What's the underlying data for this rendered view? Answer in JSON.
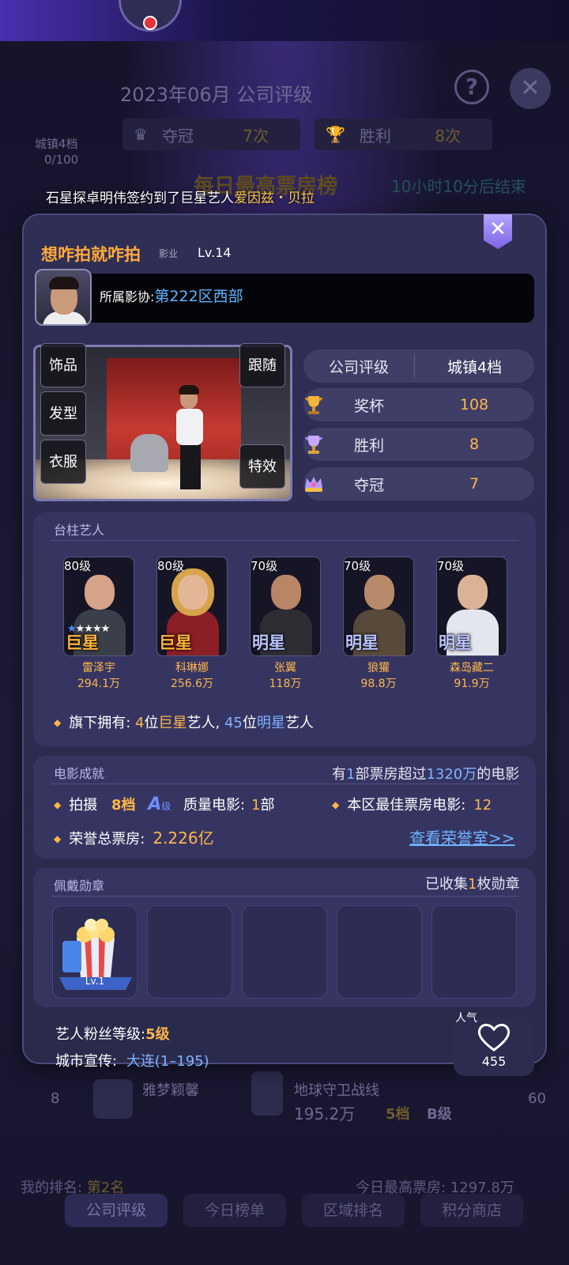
{
  "background": {
    "title": "2023年06月 公司评级",
    "help_icon": "?",
    "champion_label": "夺冠",
    "champion_count": "7次",
    "win_label": "胜利",
    "win_count": "8次",
    "town_level": "城镇4档",
    "town_progress": "0/100",
    "rank_title": "每日最高票房榜",
    "rank_countdown": "10小时10分后结束",
    "row_rank": "8",
    "row_name": "雅梦颖馨",
    "row_movie": "地球守卫战线",
    "row_box": "195.2万",
    "row_grade": "5档",
    "row_level": "B级",
    "row_score": "60",
    "my_rank_label": "我的排名:",
    "my_rank_value": "第2名",
    "today_best_label": "今日最高票房:",
    "today_best_value": "1297.8万",
    "tabs": [
      "公司评级",
      "今日榜单",
      "区域排名",
      "积分商店"
    ]
  },
  "notice": {
    "prefix": "石星探卓明伟签约到了巨星艺人",
    "highlight": "爱因兹・贝拉"
  },
  "panel": {
    "company_name": "想咋拍就咋拍",
    "company_tag": "影业",
    "level": "Lv.14",
    "guild_label": "所属影协:",
    "guild_name": "第222区西部",
    "studio_buttons": {
      "accessories": "饰品",
      "hairstyle": "发型",
      "clothing": "衣服",
      "follow": "跟随",
      "effects": "特效"
    },
    "stats": {
      "rating_label": "公司评级",
      "rating_value": "城镇4档",
      "trophy_label": "奖杯",
      "trophy_value": "108",
      "win_label": "胜利",
      "win_value": "8",
      "champion_label": "夺冠",
      "champion_value": "7"
    },
    "artists_section": {
      "title": "台柱艺人",
      "artists": [
        {
          "level": "80级",
          "rank": "巨星",
          "name": "雷泽宇",
          "fans": "294.1万"
        },
        {
          "level": "80级",
          "rank": "巨星",
          "name": "科琳娜",
          "fans": "256.6万"
        },
        {
          "level": "70级",
          "rank": "明星",
          "name": "张翼",
          "fans": "118万"
        },
        {
          "level": "70级",
          "rank": "明星",
          "name": "狼獾",
          "fans": "98.8万"
        },
        {
          "level": "70级",
          "rank": "明星",
          "name": "森岛藏二",
          "fans": "91.9万"
        }
      ],
      "owned_prefix": "旗下拥有: ",
      "superstar_count": "4",
      "superstar_unit": "位",
      "superstar_label": "巨星",
      "artist_word": "艺人, ",
      "star_count": "45",
      "star_unit": "位",
      "star_label": "明星",
      "artist_word2": "艺人"
    },
    "movies_section": {
      "title": "电影成就",
      "summary_prefix": "有",
      "summary_count": "1",
      "summary_mid": "部票房超过",
      "summary_amount": "1320万",
      "summary_suffix": "的电影",
      "shoot_label": "拍摄",
      "shoot_grade": "8档",
      "shoot_level": "A",
      "shoot_level_unit": "级",
      "quality_label": "质量电影:",
      "quality_count": "1",
      "quality_unit": "部",
      "best_label": "本区最佳票房电影:",
      "best_value": "12",
      "honor_label": "荣誉总票房:",
      "honor_value": "2.226亿",
      "honor_link": "查看荣誉室>>"
    },
    "medals_section": {
      "title": "佩戴勋章",
      "collected_prefix": "已收集",
      "collected_count": "1",
      "collected_suffix": "枚勋章",
      "medal_level": "Lv.1"
    },
    "fan_level_label": "艺人粉丝等级:",
    "fan_level_value": "5级",
    "city_promo_label": "城市宣传:",
    "city_promo_value": "大连(1–195)",
    "popularity_label": "人气",
    "popularity_value": "455"
  },
  "colors": {
    "accent_gold": "#ffb64a",
    "accent_blue": "#7fb2ff",
    "panel_bg": "#2f2e55"
  }
}
